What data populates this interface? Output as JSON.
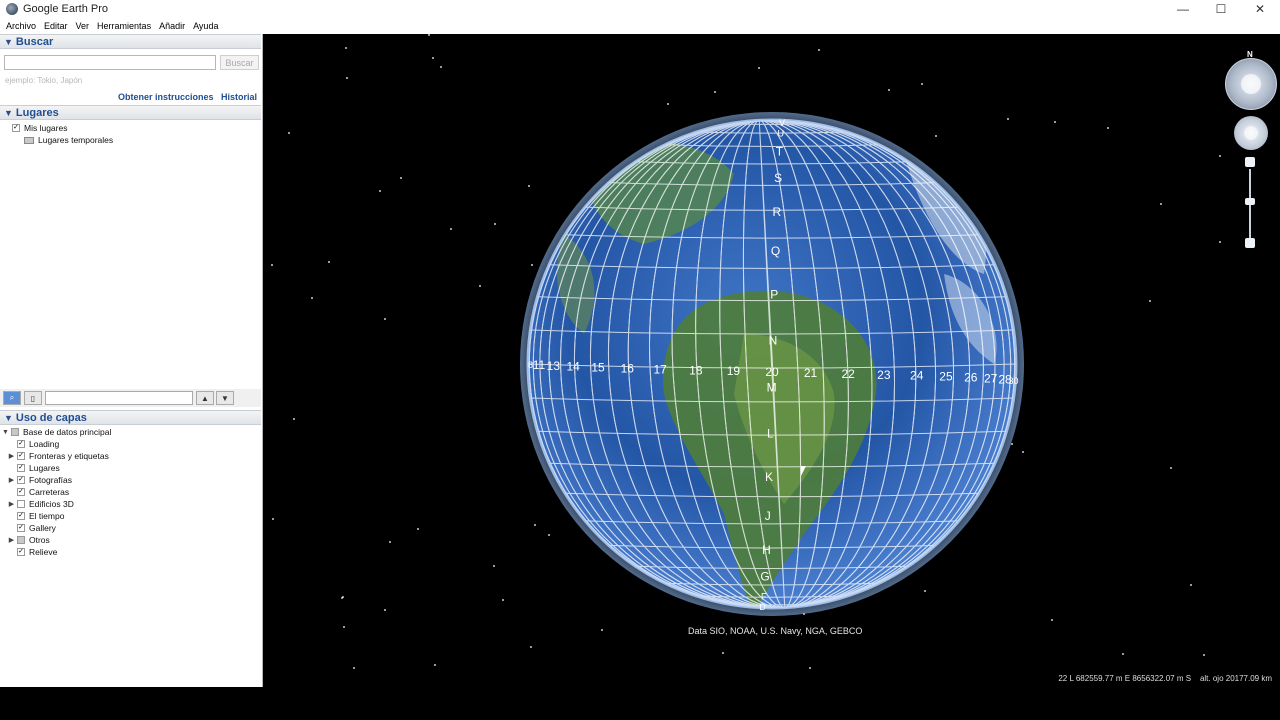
{
  "window": {
    "title": "Google Earth Pro",
    "minimize": "—",
    "maximize": "☐",
    "close": "✕"
  },
  "menu": [
    "Archivo",
    "Editar",
    "Ver",
    "Herramientas",
    "Añadir",
    "Ayuda"
  ],
  "search": {
    "header": "Buscar",
    "placeholder": "",
    "button": "Buscar",
    "hint": "ejemplo: Tokio, Japón",
    "directions_link": "Obtener instrucciones",
    "history_link": "Historial"
  },
  "places": {
    "header": "Lugares",
    "items": [
      {
        "label": "Mis lugares",
        "checked": true
      },
      {
        "label": "Lugares temporales",
        "checked": false
      }
    ]
  },
  "layers": {
    "header": "Uso de capas",
    "root": "Base de datos principal",
    "items": [
      {
        "label": "Loading",
        "checked": true,
        "expandable": false
      },
      {
        "label": "Fronteras y etiquetas",
        "checked": true,
        "expandable": true
      },
      {
        "label": "Lugares",
        "checked": true,
        "expandable": false
      },
      {
        "label": "Fotografías",
        "checked": true,
        "expandable": true
      },
      {
        "label": "Carreteras",
        "checked": true,
        "expandable": false
      },
      {
        "label": "Edificios 3D",
        "checked": false,
        "expandable": true
      },
      {
        "label": "El tiempo",
        "checked": true,
        "expandable": false
      },
      {
        "label": "Gallery",
        "checked": true,
        "expandable": false
      },
      {
        "label": "Otros",
        "checked": "partial",
        "expandable": true
      },
      {
        "label": "Relieve",
        "checked": true,
        "expandable": false
      }
    ]
  },
  "globe": {
    "zone_numbers": [
      "8",
      "11",
      "13",
      "14",
      "15",
      "16",
      "17",
      "18",
      "19",
      "20",
      "21",
      "22",
      "23",
      "24",
      "25",
      "26",
      "27",
      "28",
      "30"
    ],
    "band_letters": [
      "V",
      "U",
      "T",
      "S",
      "R",
      "Q",
      "P",
      "N",
      "M",
      "L",
      "K",
      "J",
      "H",
      "G",
      "F",
      "D"
    ],
    "credits": "Data SIO, NOAA, U.S. Navy, NGA, GEBCO"
  },
  "navigation": {
    "north": "N"
  },
  "status_bar": {
    "coordinates": "22 L 682559.77 m E 8656322.07 m S",
    "eye_altitude": "alt. ojo 20177.09 km"
  },
  "colors": {
    "sidebar_header": "#1f4f93",
    "link": "#1f4f93",
    "globe_ocean": "#2a5aa8",
    "grid": "#ffffff"
  }
}
